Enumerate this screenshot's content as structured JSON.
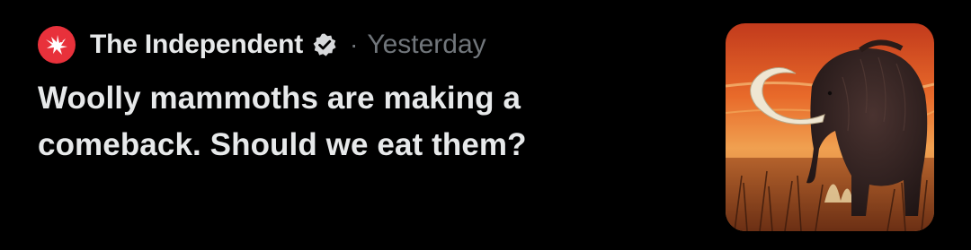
{
  "card": {
    "source_name": "The Independent",
    "separator": "·",
    "timestamp": "Yesterday",
    "headline": "Woolly mammoths are making a comeback. Should we eat them?",
    "avatar_icon": "eagle-logo-icon",
    "verified_icon": "verified-badge-icon",
    "thumbnail_subject": "woolly-mammoth-illustration"
  },
  "colors": {
    "background": "#000000",
    "primary_text": "#e7e9ea",
    "secondary_text": "#71767b",
    "brand_red": "#e8313b",
    "verified_grey": "#d7d9db"
  }
}
